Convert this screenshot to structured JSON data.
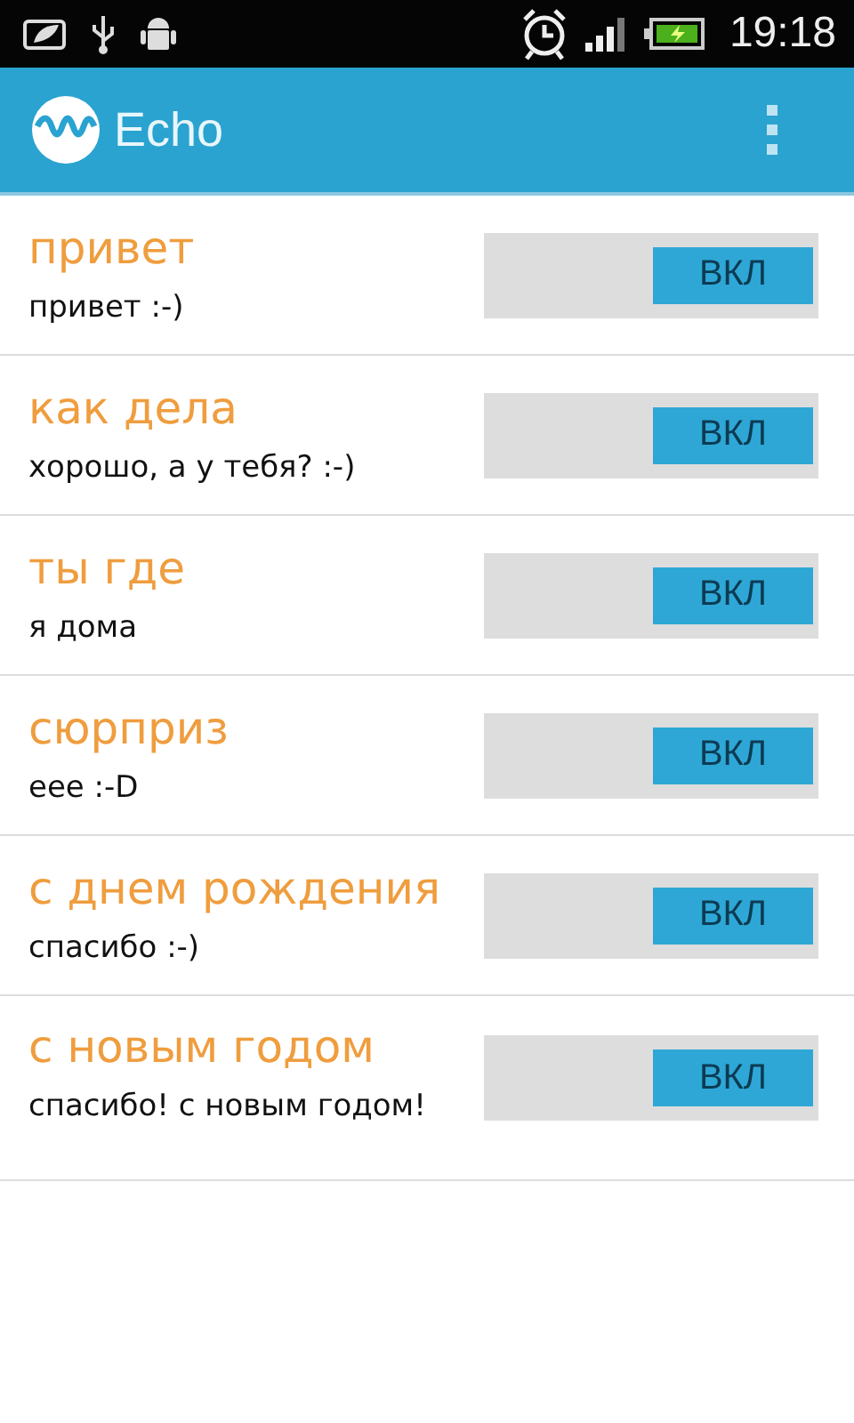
{
  "status_bar": {
    "time": "19:18"
  },
  "app_bar": {
    "title": "Echo"
  },
  "rules": [
    {
      "trigger": "привет",
      "reply": "привет :-)",
      "toggle": {
        "label": "ВКЛ",
        "on": true
      }
    },
    {
      "trigger": "как дела",
      "reply": "хорошо, а у тебя? :-)",
      "toggle": {
        "label": "ВКЛ",
        "on": true
      }
    },
    {
      "trigger": "ты где",
      "reply": "я дома",
      "toggle": {
        "label": "ВКЛ",
        "on": true
      }
    },
    {
      "trigger": "сюрприз",
      "reply": "еее :-D",
      "toggle": {
        "label": "ВКЛ",
        "on": true
      }
    },
    {
      "trigger": "с днем рождения",
      "reply": "спасибо :-)",
      "toggle": {
        "label": "ВКЛ",
        "on": true
      }
    },
    {
      "trigger": "с новым годом",
      "reply": "спасибо! с новым годом!",
      "toggle": {
        "label": "ВКЛ",
        "on": true
      }
    }
  ]
}
